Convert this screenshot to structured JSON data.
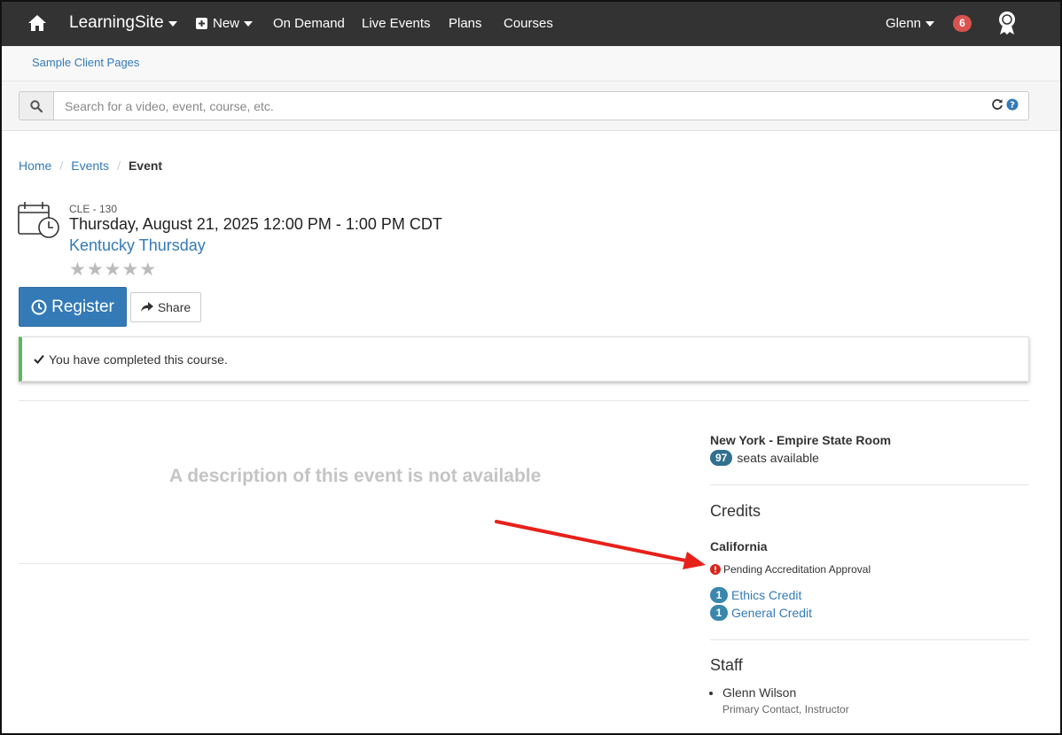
{
  "nav": {
    "brand": "LearningSite",
    "new_label": "New",
    "on_demand": "On Demand",
    "live_events": "Live Events",
    "plans": "Plans",
    "courses": "Courses",
    "user": "Glenn",
    "notification_count": "6"
  },
  "subnav": {
    "link": "Sample Client Pages"
  },
  "search": {
    "placeholder": "Search for a video, event, course, etc."
  },
  "breadcrumb": {
    "home": "Home",
    "events": "Events",
    "current": "Event"
  },
  "event": {
    "code": "CLE - 130",
    "date": "Thursday, August 21, 2025 12:00 PM - 1:00 PM CDT",
    "title": "Kentucky Thursday",
    "rating": 0,
    "register_label": "Register",
    "share_label": "Share",
    "completed_msg": "You have completed this course.",
    "no_description": "A description of this event is not available"
  },
  "location": {
    "room": "New York - Empire State Room",
    "seats_count": "97",
    "seats_label": "seats available"
  },
  "credits": {
    "heading": "Credits",
    "state": "California",
    "status": "Pending Accreditation Approval",
    "items": [
      {
        "count": "1",
        "label": "Ethics Credit"
      },
      {
        "count": "1",
        "label": "General Credit"
      }
    ]
  },
  "staff": {
    "heading": "Staff",
    "members": [
      {
        "name": "Glenn Wilson",
        "role": "Primary Contact, Instructor"
      }
    ]
  },
  "colors": {
    "navbar": "#333333",
    "primary": "#337ab7",
    "success": "#5cb85c",
    "badge_red": "#d9534f",
    "annotation_arrow": "#e8201a"
  }
}
